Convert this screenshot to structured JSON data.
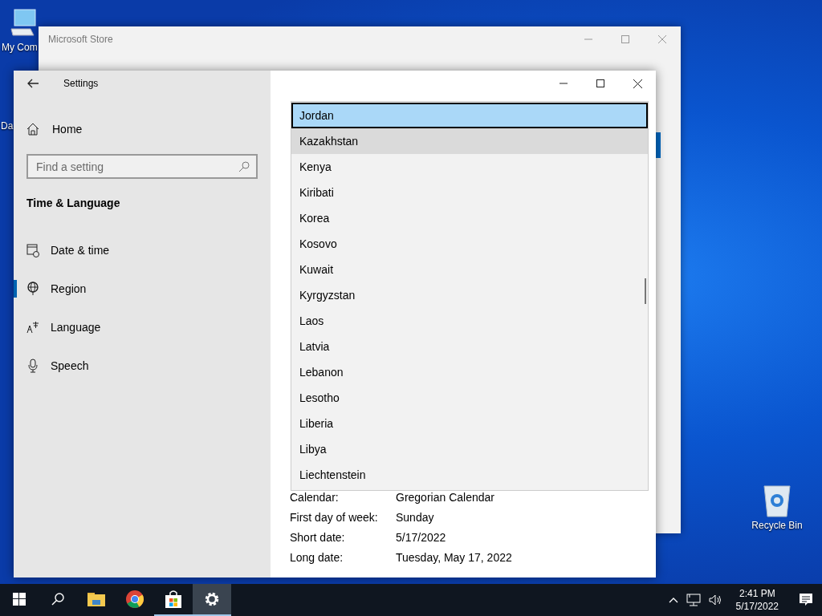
{
  "desktop_icons": [
    {
      "kind": "computer",
      "label": "My Com"
    },
    {
      "kind": "hidden",
      "label": "Da"
    },
    {
      "kind": "recycle",
      "label": "Recycle Bin"
    }
  ],
  "store_window": {
    "title": "Microsoft Store"
  },
  "settings": {
    "title": "Settings",
    "home": "Home",
    "search": {
      "placeholder": "Find a setting"
    },
    "section": "Time & Language",
    "nav": [
      {
        "label": "Date & time",
        "selected": false
      },
      {
        "label": "Region",
        "selected": true
      },
      {
        "label": "Language",
        "selected": false
      },
      {
        "label": "Speech",
        "selected": false
      }
    ]
  },
  "region_list": {
    "items": [
      {
        "label": "Jordan",
        "selected": true,
        "hovered": false
      },
      {
        "label": "Kazakhstan",
        "selected": false,
        "hovered": true
      },
      {
        "label": "Kenya",
        "selected": false,
        "hovered": false
      },
      {
        "label": "Kiribati",
        "selected": false,
        "hovered": false
      },
      {
        "label": "Korea",
        "selected": false,
        "hovered": false
      },
      {
        "label": "Kosovo",
        "selected": false,
        "hovered": false
      },
      {
        "label": "Kuwait",
        "selected": false,
        "hovered": false
      },
      {
        "label": "Kyrgyzstan",
        "selected": false,
        "hovered": false
      },
      {
        "label": "Laos",
        "selected": false,
        "hovered": false
      },
      {
        "label": "Latvia",
        "selected": false,
        "hovered": false
      },
      {
        "label": "Lebanon",
        "selected": false,
        "hovered": false
      },
      {
        "label": "Lesotho",
        "selected": false,
        "hovered": false
      },
      {
        "label": "Liberia",
        "selected": false,
        "hovered": false
      },
      {
        "label": "Libya",
        "selected": false,
        "hovered": false
      },
      {
        "label": "Liechtenstein",
        "selected": false,
        "hovered": false
      }
    ]
  },
  "details": [
    {
      "label": "Calendar:",
      "value": "Gregorian Calendar"
    },
    {
      "label": "First day of week:",
      "value": "Sunday"
    },
    {
      "label": "Short date:",
      "value": "5/17/2022"
    },
    {
      "label": "Long date:",
      "value": "Tuesday, May 17, 2022"
    }
  ],
  "taskbar": {
    "apps": [
      {
        "kind": "start",
        "running": false,
        "active": false
      },
      {
        "kind": "search",
        "running": false,
        "active": false
      },
      {
        "kind": "explorer",
        "running": false,
        "active": false
      },
      {
        "kind": "chrome",
        "running": false,
        "active": false
      },
      {
        "kind": "store",
        "running": true,
        "active": false
      },
      {
        "kind": "settings",
        "running": true,
        "active": true
      }
    ],
    "time": "2:41 PM",
    "date": "5/17/2022"
  }
}
